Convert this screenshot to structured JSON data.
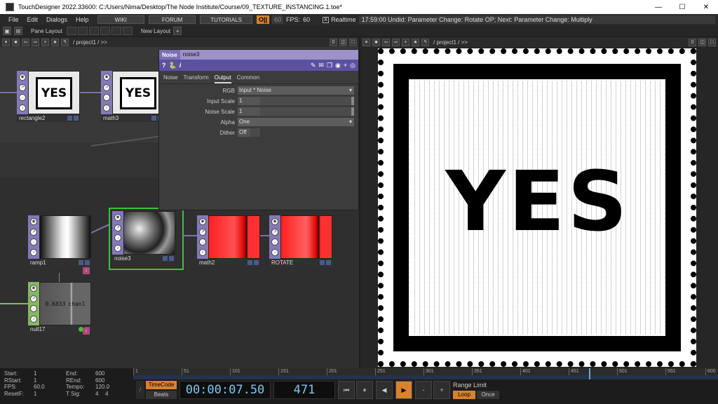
{
  "window": {
    "title": "TouchDesigner 2022.33600: C:/Users/Nima/Desktop/The Node Institute/Course/09_TEXTURE_INSTANCING.1.toe*",
    "minimize": "—",
    "maximize": "☐",
    "close": "✕"
  },
  "menubar": {
    "items": [
      "File",
      "Edit",
      "Dialogs",
      "Help"
    ],
    "wiki": "WIKI",
    "forum": "FORUM",
    "tutorials": "TUTORIALS",
    "pause_badge": "O||",
    "fps_cap": "60",
    "fps_label": "FPS:",
    "fps_value": "60",
    "realtime_label": "Realtime",
    "realtime_check": "X",
    "status": "17:59:00 Undid: Parameter Change: Rotate OP; Next: Parameter Change: Multiply"
  },
  "toolbar": {
    "pane_layout": "Pane Layout",
    "new_layout": "New Layout",
    "plus": "+"
  },
  "left_pane": {
    "path": "/ project1 / >>",
    "pane_num": "0"
  },
  "right_pane": {
    "path": "/ project1 / >>",
    "pane_num": "0"
  },
  "nodes": {
    "rectangle2": {
      "label": "rectangle2",
      "text": "YES"
    },
    "math3": {
      "label": "math3",
      "text": "YES"
    },
    "ramp1": {
      "label": "ramp1"
    },
    "noise3": {
      "label": "noise3"
    },
    "math2": {
      "label": "math2"
    },
    "rotate": {
      "label": "ROTATE"
    },
    "null17": {
      "label": "null17",
      "value": "0.6833",
      "channel": "chan1"
    }
  },
  "params": {
    "type": "Noise",
    "name": "noise3",
    "help": "?",
    "info": "i",
    "tabs": [
      "Noise",
      "Transform",
      "Output",
      "Common"
    ],
    "active_tab": "Output",
    "rows": [
      {
        "label": "RGB",
        "value": "Input * Noise",
        "kind": "dropdown"
      },
      {
        "label": "Input Scale",
        "value": "1",
        "kind": "slider"
      },
      {
        "label": "Noise Scale",
        "value": "1",
        "kind": "slider"
      },
      {
        "label": "Alpha",
        "value": "One",
        "kind": "dropdown"
      },
      {
        "label": "Dither",
        "value": "Off",
        "kind": "toggle"
      }
    ]
  },
  "viewer": {
    "text": "YES"
  },
  "timeline": {
    "start_label": "Start:",
    "start": "1",
    "rstart_label": "RStart:",
    "rstart": "1",
    "fps_label": "FPS:",
    "fps": "60.0",
    "resetf_label": "ResetF:",
    "resetf": "1",
    "end_label": "End:",
    "end": "600",
    "rend_label": "REnd:",
    "rend": "600",
    "tempo_label": "Tempo:",
    "tempo": "120.0",
    "tsig_label": "T Sig:",
    "tsig_a": "4",
    "tsig_b": "4",
    "ruler_ticks": [
      "1",
      "51",
      "101",
      "151",
      "201",
      "251",
      "301",
      "351",
      "401",
      "451",
      "501",
      "551",
      "600"
    ],
    "timecode": "TimeCode",
    "beats": "Beats",
    "clock": "00:00:07.50",
    "frame": "471",
    "range_limit": "Range Limit",
    "loop": "Loop",
    "once": "Once",
    "to_start": "⏮",
    "pause": "⏸",
    "step_back": "◀",
    "play": "▶",
    "minus": "-",
    "plus": "+"
  },
  "colors": {
    "accent_purple": "#7a6fb2",
    "selected_green": "#3cc13c",
    "pause_orange": "#d9822b",
    "clock_blue": "#7ec8f0"
  }
}
